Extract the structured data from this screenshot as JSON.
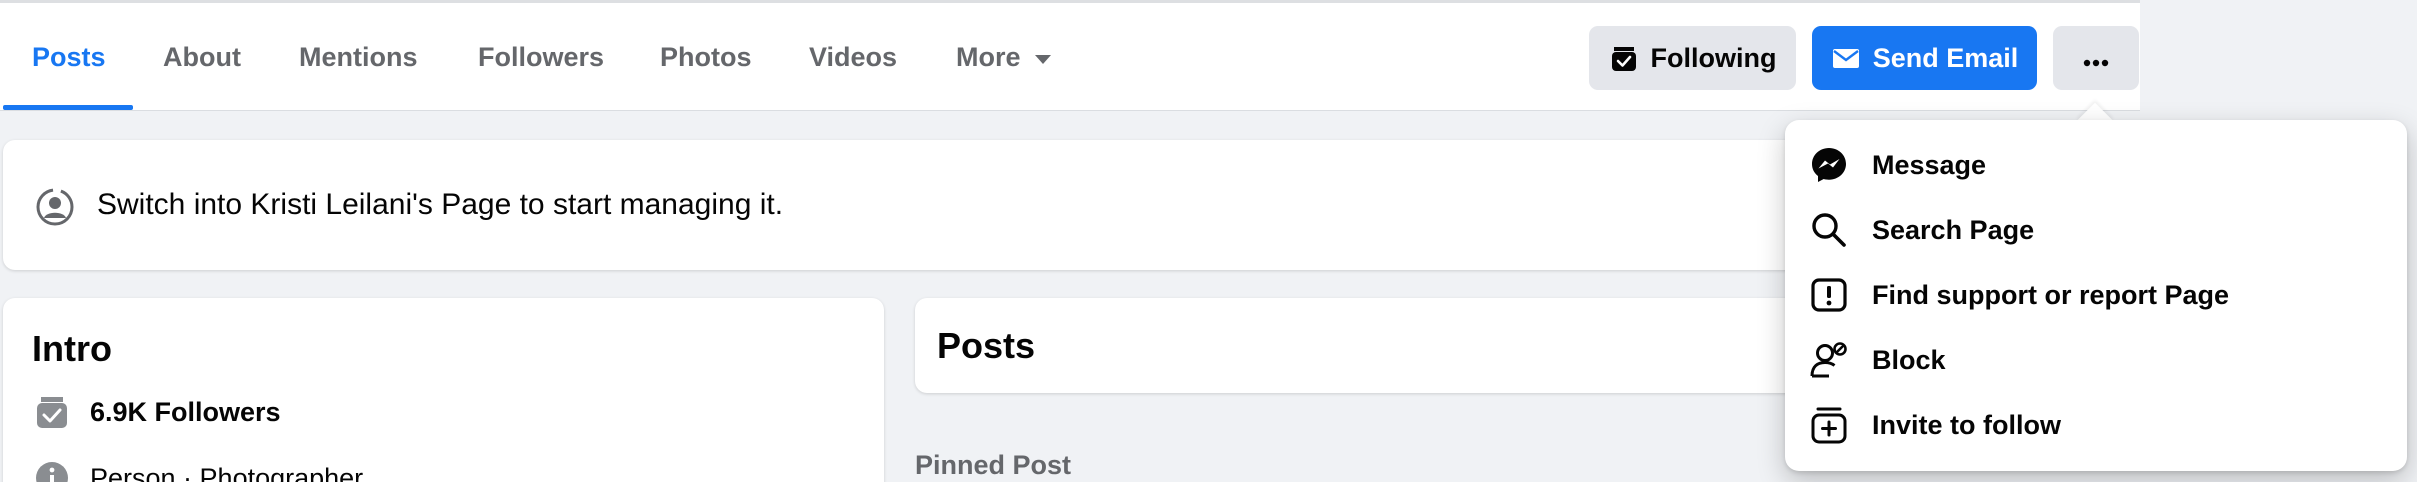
{
  "tabs": [
    {
      "label": "Posts",
      "active": true
    },
    {
      "label": "About"
    },
    {
      "label": "Mentions"
    },
    {
      "label": "Followers"
    },
    {
      "label": "Photos"
    },
    {
      "label": "Videos"
    },
    {
      "label": "More",
      "icon": "caret-down-icon"
    }
  ],
  "actions": {
    "following_label": "Following",
    "following_icon": "following-check-icon",
    "email_label": "Send Email",
    "email_icon": "envelope-icon",
    "more_icon": "ellipsis-icon"
  },
  "banner": {
    "icon": "switch-profile-icon",
    "text": "Switch into Kristi Leilani's Page to start managing it."
  },
  "intro": {
    "title": "Intro",
    "followers": "6.9K Followers",
    "followers_icon": "followers-icon",
    "second_row": "Person · Photographer",
    "second_row_icon": "info-icon"
  },
  "posts": {
    "title": "Posts",
    "pinned_label": "Pinned Post"
  },
  "dropdown": {
    "items": [
      {
        "label": "Message",
        "icon": "messenger-icon"
      },
      {
        "label": "Search Page",
        "icon": "search-icon"
      },
      {
        "label": "Find support or report Page",
        "icon": "report-icon"
      },
      {
        "label": "Block",
        "icon": "block-user-icon"
      },
      {
        "label": "Invite to follow",
        "icon": "invite-follow-icon"
      }
    ]
  },
  "colors": {
    "accent": "#1877f2",
    "page_background": "#f0f2f5",
    "secondary_text": "#65676b",
    "button_gray": "#e4e6eb"
  }
}
